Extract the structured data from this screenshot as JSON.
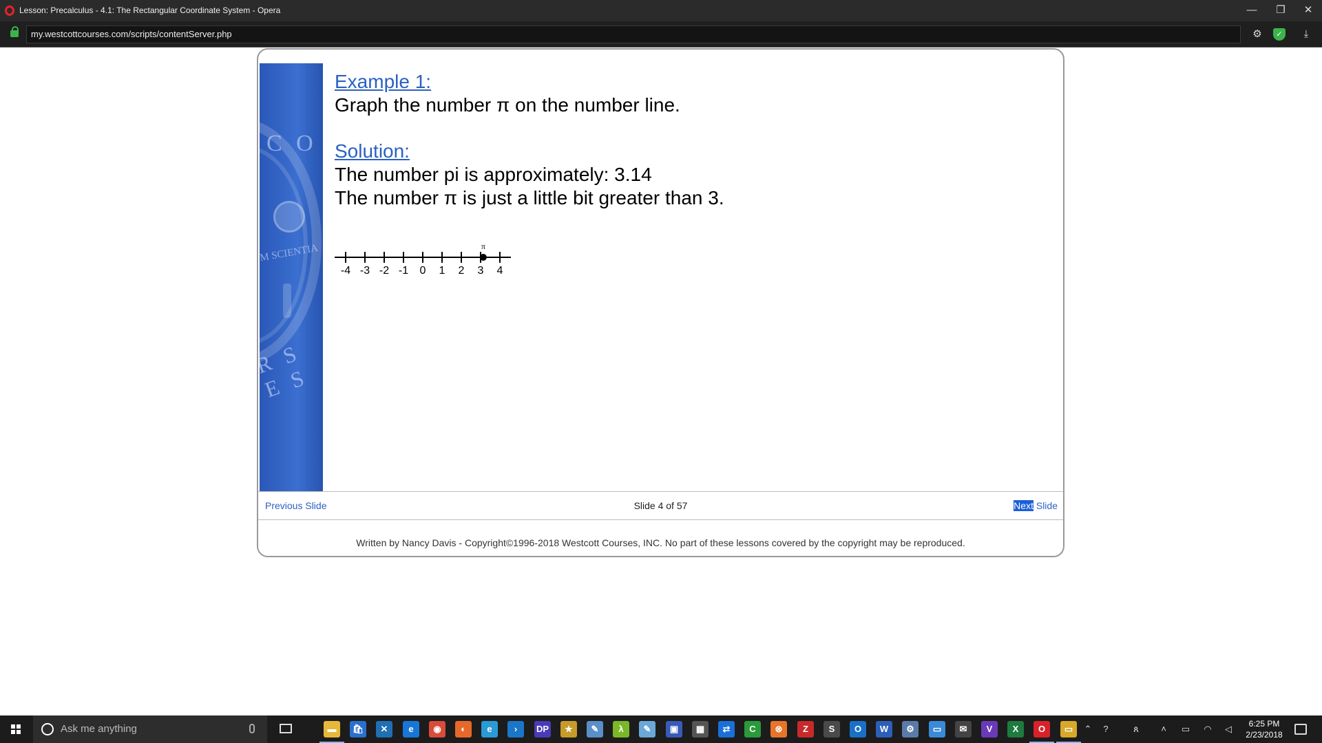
{
  "window": {
    "title": "Lesson: Precalculus - 4.1: The Rectangular Coordinate System - Opera",
    "url": "my.westcottcourses.com/scripts/contentServer.php",
    "minimize": "—",
    "restore": "❐",
    "close": "✕"
  },
  "slide": {
    "example_heading": "Example 1:",
    "example_text": "Graph the number π on the number line.",
    "solution_heading": "Solution:",
    "solution_line1": "The number pi is approximately:  3.14",
    "solution_line2": "The number π is just a little bit greater than 3.",
    "number_line": {
      "ticks": [
        "-4",
        "-3",
        "-2",
        "-1",
        "0",
        "1",
        "2",
        "3",
        "4"
      ],
      "point_label": "π",
      "point_value": 3.14
    },
    "banner_text": {
      "co": "C O",
      "scientia": "M SCIENTIA",
      "rses": "R S E S"
    }
  },
  "nav": {
    "previous": "Previous Slide",
    "counter": "Slide 4 of 57",
    "next_highlight": "Next",
    "next_rest": " Slide"
  },
  "footer": "Written by Nancy Davis - Copyright©1996-2018 Westcott Courses, INC. No part of these lessons covered by the copyright may be reproduced.",
  "taskbar": {
    "search_placeholder": "Ask me anything",
    "time": "6:25 PM",
    "date": "2/23/2018",
    "apps": [
      {
        "icon": "file-explorer-icon",
        "glyph": "▬",
        "color": "#e8b83a"
      },
      {
        "icon": "store-icon",
        "glyph": "🛍",
        "color": "#2b6fd0"
      },
      {
        "icon": "tool-icon",
        "glyph": "✕",
        "color": "#1f6fb5"
      },
      {
        "icon": "edge-icon",
        "glyph": "e",
        "color": "#1877d6"
      },
      {
        "icon": "chrome-icon",
        "glyph": "◉",
        "color": "#d94b3a"
      },
      {
        "icon": "firefox-icon",
        "glyph": "◐",
        "color": "#e8682a"
      },
      {
        "icon": "ie-icon",
        "glyph": "e",
        "color": "#2a9ad6"
      },
      {
        "icon": "powershell-icon",
        "glyph": "›",
        "color": "#1b76c8"
      },
      {
        "icon": "dp-icon",
        "glyph": "DP",
        "color": "#4a3ab8"
      },
      {
        "icon": "star-icon",
        "glyph": "★",
        "color": "#c89a2a"
      },
      {
        "icon": "paint-icon",
        "glyph": "✎",
        "color": "#5a8fc8"
      },
      {
        "icon": "lambda-icon",
        "glyph": "λ",
        "color": "#7ab82a"
      },
      {
        "icon": "notepad-icon",
        "glyph": "✎",
        "color": "#6aa8d8"
      },
      {
        "icon": "media-icon",
        "glyph": "▣",
        "color": "#3a5ab8"
      },
      {
        "icon": "calculator-icon",
        "glyph": "▦",
        "color": "#555555"
      },
      {
        "icon": "teamviewer-icon",
        "glyph": "⇄",
        "color": "#1a6fd8"
      },
      {
        "icon": "camtasia-icon",
        "glyph": "C",
        "color": "#2a9a3a"
      },
      {
        "icon": "xampp-icon",
        "glyph": "⊗",
        "color": "#e8742a"
      },
      {
        "icon": "filezilla-icon",
        "glyph": "Z",
        "color": "#c82a2a"
      },
      {
        "icon": "sublime-icon",
        "glyph": "S",
        "color": "#4a4a4a"
      },
      {
        "icon": "outlook-icon",
        "glyph": "O",
        "color": "#1a6fc8"
      },
      {
        "icon": "word-icon",
        "glyph": "W",
        "color": "#2b5fb8"
      },
      {
        "icon": "settings-app-icon",
        "glyph": "⚙",
        "color": "#5a7aa8"
      },
      {
        "icon": "remote-icon",
        "glyph": "▭",
        "color": "#3a8ad8"
      },
      {
        "icon": "mail-icon",
        "glyph": "✉",
        "color": "#444444"
      },
      {
        "icon": "visual-studio-icon",
        "glyph": "V",
        "color": "#6a3ab8"
      },
      {
        "icon": "excel-icon",
        "glyph": "X",
        "color": "#1e7a3e"
      },
      {
        "icon": "opera-icon",
        "glyph": "O",
        "color": "#d8222a"
      },
      {
        "icon": "slideshow-icon",
        "glyph": "▭",
        "color": "#d8a82a"
      }
    ]
  }
}
